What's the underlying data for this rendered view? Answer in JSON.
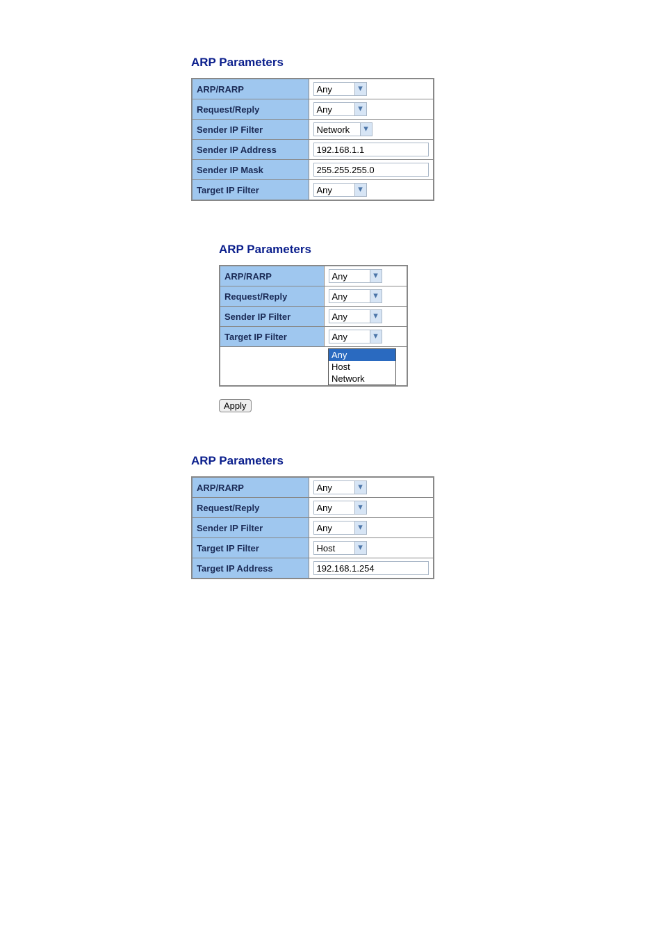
{
  "section1": {
    "title": "ARP Parameters",
    "rows": {
      "arp_rarp": {
        "label": "ARP/RARP",
        "value": "Any"
      },
      "request_reply": {
        "label": "Request/Reply",
        "value": "Any"
      },
      "sender_ip_filter": {
        "label": "Sender IP Filter",
        "value": "Network"
      },
      "sender_ip_address": {
        "label": "Sender IP Address",
        "value": "192.168.1.1"
      },
      "sender_ip_mask": {
        "label": "Sender IP Mask",
        "value": "255.255.255.0"
      },
      "target_ip_filter": {
        "label": "Target IP Filter",
        "value": "Any"
      }
    }
  },
  "section2": {
    "title": "ARP Parameters",
    "rows": {
      "arp_rarp": {
        "label": "ARP/RARP",
        "value": "Any"
      },
      "request_reply": {
        "label": "Request/Reply",
        "value": "Any"
      },
      "sender_ip_filter": {
        "label": "Sender IP Filter",
        "value": "Any"
      },
      "target_ip_filter": {
        "label": "Target IP Filter",
        "value": "Any"
      }
    },
    "dropdown_options": [
      "Any",
      "Host",
      "Network"
    ],
    "selected_option": "Any",
    "apply_label": "Apply"
  },
  "section3": {
    "title": "ARP Parameters",
    "rows": {
      "arp_rarp": {
        "label": "ARP/RARP",
        "value": "Any"
      },
      "request_reply": {
        "label": "Request/Reply",
        "value": "Any"
      },
      "sender_ip_filter": {
        "label": "Sender IP Filter",
        "value": "Any"
      },
      "target_ip_filter": {
        "label": "Target IP Filter",
        "value": "Host"
      },
      "target_ip_address": {
        "label": "Target IP Address",
        "value": "192.168.1.254"
      }
    }
  }
}
